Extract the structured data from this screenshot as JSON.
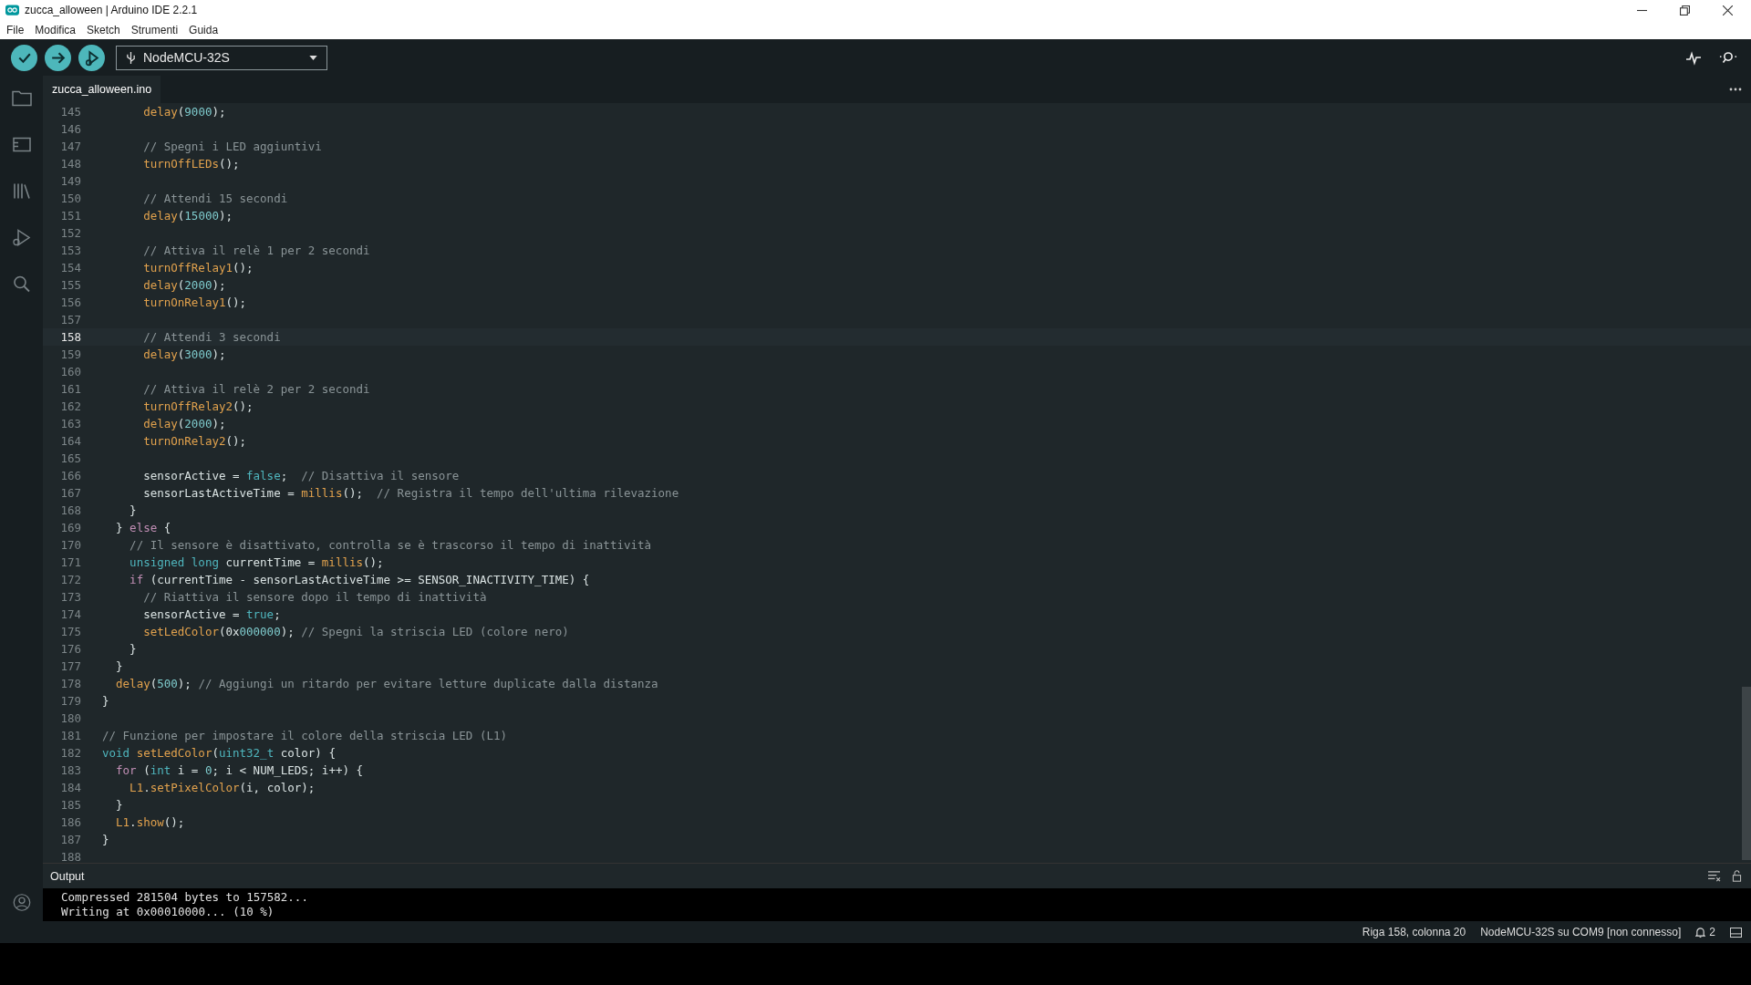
{
  "window": {
    "title": "zucca_alloween | Arduino IDE 2.2.1"
  },
  "menu": [
    "File",
    "Modifica",
    "Sketch",
    "Strumenti",
    "Guida"
  ],
  "toolbar": {
    "board": "NodeMCU-32S"
  },
  "tabs": [
    {
      "label": "zucca_alloween.ino",
      "selected": true
    }
  ],
  "editor": {
    "lines": [
      {
        "no": "145",
        "current": false,
        "tokens": [
          {
            "text": "      delay",
            "kind": "fn"
          },
          {
            "text": "(",
            "kind": "plain"
          },
          {
            "text": "9000",
            "kind": "num"
          },
          {
            "text": ");",
            "kind": "plain"
          }
        ]
      },
      {
        "no": "146",
        "current": false
      },
      {
        "no": "147",
        "current": false,
        "tokens": [
          {
            "text": "      // Spegni i LED aggiuntivi",
            "kind": "comment"
          }
        ]
      },
      {
        "no": "148",
        "current": false,
        "tokens": [
          {
            "text": "      turnOffLEDs",
            "kind": "fn"
          },
          {
            "text": "();",
            "kind": "plain"
          }
        ]
      },
      {
        "no": "149",
        "current": false
      },
      {
        "no": "150",
        "current": false,
        "tokens": [
          {
            "text": "      // Attendi 15 secondi",
            "kind": "comment"
          }
        ]
      },
      {
        "no": "151",
        "current": false,
        "tokens": [
          {
            "text": "      delay",
            "kind": "fn"
          },
          {
            "text": "(",
            "kind": "plain"
          },
          {
            "text": "15000",
            "kind": "num"
          },
          {
            "text": ");",
            "kind": "plain"
          }
        ]
      },
      {
        "no": "152",
        "current": false
      },
      {
        "no": "153",
        "current": false,
        "tokens": [
          {
            "text": "      // Attiva il relè 1 per 2 secondi",
            "kind": "comment"
          }
        ]
      },
      {
        "no": "154",
        "current": false,
        "tokens": [
          {
            "text": "      turnOffRelay1",
            "kind": "fn"
          },
          {
            "text": "();",
            "kind": "plain"
          }
        ]
      },
      {
        "no": "155",
        "current": false,
        "tokens": [
          {
            "text": "      delay",
            "kind": "fn"
          },
          {
            "text": "(",
            "kind": "plain"
          },
          {
            "text": "2000",
            "kind": "num"
          },
          {
            "text": ");",
            "kind": "plain"
          }
        ]
      },
      {
        "no": "156",
        "current": false,
        "tokens": [
          {
            "text": "      turnOnRelay1",
            "kind": "fn"
          },
          {
            "text": "();",
            "kind": "plain"
          }
        ]
      },
      {
        "no": "157",
        "current": false
      },
      {
        "no": "158",
        "current": true,
        "tokens": [
          {
            "text": "      // Attendi 3 secondi",
            "kind": "comment"
          }
        ]
      },
      {
        "no": "159",
        "current": false,
        "tokens": [
          {
            "text": "      delay",
            "kind": "fn"
          },
          {
            "text": "(",
            "kind": "plain"
          },
          {
            "text": "3000",
            "kind": "num"
          },
          {
            "text": ");",
            "kind": "plain"
          }
        ]
      },
      {
        "no": "160",
        "current": false
      },
      {
        "no": "161",
        "current": false,
        "tokens": [
          {
            "text": "      // Attiva il relè 2 per 2 secondi",
            "kind": "comment"
          }
        ]
      },
      {
        "no": "162",
        "current": false,
        "tokens": [
          {
            "text": "      turnOffRelay2",
            "kind": "fn"
          },
          {
            "text": "();",
            "kind": "plain"
          }
        ]
      },
      {
        "no": "163",
        "current": false,
        "tokens": [
          {
            "text": "      delay",
            "kind": "fn"
          },
          {
            "text": "(",
            "kind": "plain"
          },
          {
            "text": "2000",
            "kind": "num"
          },
          {
            "text": ");",
            "kind": "plain"
          }
        ]
      },
      {
        "no": "164",
        "current": false,
        "tokens": [
          {
            "text": "      turnOnRelay2",
            "kind": "fn"
          },
          {
            "text": "();",
            "kind": "plain"
          }
        ]
      },
      {
        "no": "165",
        "current": false
      },
      {
        "no": "166",
        "current": false,
        "tokens": [
          {
            "text": "      sensorActive = ",
            "kind": "plain"
          },
          {
            "text": "false",
            "kind": "type"
          },
          {
            "text": ";  ",
            "kind": "plain"
          },
          {
            "text": "// Disattiva il sensore",
            "kind": "comment"
          }
        ]
      },
      {
        "no": "167",
        "current": false,
        "tokens": [
          {
            "text": "      sensorLastActiveTime = ",
            "kind": "plain"
          },
          {
            "text": "millis",
            "kind": "fn"
          },
          {
            "text": "();  ",
            "kind": "plain"
          },
          {
            "text": "// Registra il tempo dell'ultima rilevazione",
            "kind": "comment"
          }
        ]
      },
      {
        "no": "168",
        "current": false,
        "tokens": [
          {
            "text": "    }",
            "kind": "plain"
          }
        ]
      },
      {
        "no": "169",
        "current": false,
        "tokens": [
          {
            "text": "  } ",
            "kind": "plain"
          },
          {
            "text": "else",
            "kind": "keyword"
          },
          {
            "text": " {",
            "kind": "plain"
          }
        ]
      },
      {
        "no": "170",
        "current": false,
        "tokens": [
          {
            "text": "    // Il sensore è disattivato, controlla se è trascorso il tempo di inattività",
            "kind": "comment"
          }
        ]
      },
      {
        "no": "171",
        "current": false,
        "tokens": [
          {
            "text": "    unsigned long",
            "kind": "type"
          },
          {
            "text": " currentTime = ",
            "kind": "plain"
          },
          {
            "text": "millis",
            "kind": "fn"
          },
          {
            "text": "();",
            "kind": "plain"
          }
        ]
      },
      {
        "no": "172",
        "current": false,
        "tokens": [
          {
            "text": "    if",
            "kind": "keyword"
          },
          {
            "text": " (currentTime - sensorLastActiveTime >= SENSOR_INACTIVITY_TIME) {",
            "kind": "plain"
          }
        ]
      },
      {
        "no": "173",
        "current": false,
        "tokens": [
          {
            "text": "      // Riattiva il sensore dopo il tempo di inattività",
            "kind": "comment"
          }
        ]
      },
      {
        "no": "174",
        "current": false,
        "tokens": [
          {
            "text": "      sensorActive = ",
            "kind": "plain"
          },
          {
            "text": "true",
            "kind": "type"
          },
          {
            "text": ";",
            "kind": "plain"
          }
        ]
      },
      {
        "no": "175",
        "current": false,
        "tokens": [
          {
            "text": "      setLedColor",
            "kind": "fn"
          },
          {
            "text": "(0x",
            "kind": "plain"
          },
          {
            "text": "000000",
            "kind": "num"
          },
          {
            "text": "); ",
            "kind": "plain"
          },
          {
            "text": "// Spegni la striscia LED (colore nero)",
            "kind": "comment"
          }
        ]
      },
      {
        "no": "176",
        "current": false,
        "tokens": [
          {
            "text": "    }",
            "kind": "plain"
          }
        ]
      },
      {
        "no": "177",
        "current": false,
        "tokens": [
          {
            "text": "  }",
            "kind": "plain"
          }
        ]
      },
      {
        "no": "178",
        "current": false,
        "tokens": [
          {
            "text": "  delay",
            "kind": "fn"
          },
          {
            "text": "(",
            "kind": "plain"
          },
          {
            "text": "500",
            "kind": "num"
          },
          {
            "text": "); ",
            "kind": "plain"
          },
          {
            "text": "// Aggiungi un ritardo per evitare letture duplicate dalla distanza",
            "kind": "comment"
          }
        ]
      },
      {
        "no": "179",
        "current": false,
        "tokens": [
          {
            "text": "}",
            "kind": "plain"
          }
        ]
      },
      {
        "no": "180",
        "current": false
      },
      {
        "no": "181",
        "current": false,
        "tokens": [
          {
            "text": "// Funzione per impostare il colore della striscia LED (L1)",
            "kind": "comment"
          }
        ]
      },
      {
        "no": "182",
        "current": false,
        "tokens": [
          {
            "text": "void ",
            "kind": "type"
          },
          {
            "text": "setLedColor",
            "kind": "fn"
          },
          {
            "text": "(",
            "kind": "plain"
          },
          {
            "text": "uint32_t",
            "kind": "type"
          },
          {
            "text": " color) {",
            "kind": "plain"
          }
        ]
      },
      {
        "no": "183",
        "current": false,
        "tokens": [
          {
            "text": "  for",
            "kind": "keyword"
          },
          {
            "text": " (",
            "kind": "plain"
          },
          {
            "text": "int",
            "kind": "type"
          },
          {
            "text": " i = ",
            "kind": "plain"
          },
          {
            "text": "0",
            "kind": "num"
          },
          {
            "text": "; i < NUM_LEDS; i++) {",
            "kind": "plain"
          }
        ]
      },
      {
        "no": "184",
        "current": false,
        "tokens": [
          {
            "text": "    L1",
            "kind": "fn"
          },
          {
            "text": ".",
            "kind": "plain"
          },
          {
            "text": "setPixelColor",
            "kind": "fn"
          },
          {
            "text": "(i, color);",
            "kind": "plain"
          }
        ]
      },
      {
        "no": "185",
        "current": false,
        "tokens": [
          {
            "text": "  }",
            "kind": "plain"
          }
        ]
      },
      {
        "no": "186",
        "current": false,
        "tokens": [
          {
            "text": "  L1",
            "kind": "fn"
          },
          {
            "text": ".",
            "kind": "plain"
          },
          {
            "text": "show",
            "kind": "fn"
          },
          {
            "text": "();",
            "kind": "plain"
          }
        ]
      },
      {
        "no": "187",
        "current": false,
        "tokens": [
          {
            "text": "}",
            "kind": "plain"
          }
        ]
      },
      {
        "no": "188",
        "current": false
      }
    ]
  },
  "output": {
    "title": "Output",
    "lines": [
      "Compressed 281504 bytes to 157582...",
      "Writing at 0x00010000... (10 %)"
    ]
  },
  "status_bar": {
    "position": "Riga 158, colonna 20",
    "board": "NodeMCU-32S su COM9 [non connesso]",
    "notifications": "2"
  }
}
